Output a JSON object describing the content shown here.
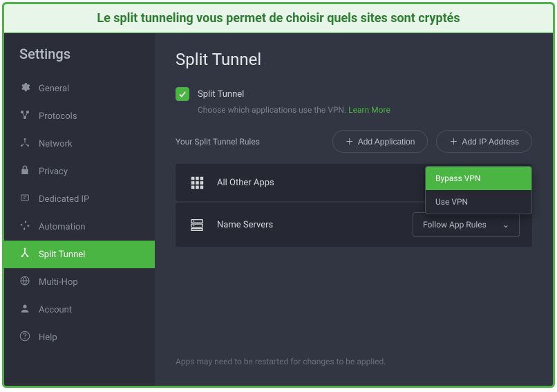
{
  "banner": {
    "text": "Le split tunneling vous permet de choisir quels sites sont cryptés"
  },
  "sidebar": {
    "title": "Settings",
    "items": [
      {
        "label": "General"
      },
      {
        "label": "Protocols"
      },
      {
        "label": "Network"
      },
      {
        "label": "Privacy"
      },
      {
        "label": "Dedicated IP"
      },
      {
        "label": "Automation"
      },
      {
        "label": "Split Tunnel"
      },
      {
        "label": "Multi-Hop"
      },
      {
        "label": "Account"
      },
      {
        "label": "Help"
      }
    ],
    "active_index": 6
  },
  "main": {
    "title": "Split Tunnel",
    "checkbox_label": "Split Tunnel",
    "helper_text": "Choose which applications use the VPN.",
    "learn_more": "Learn More",
    "rules_label": "Your Split Tunnel Rules",
    "add_app_btn": "Add Application",
    "add_ip_btn": "Add IP Address",
    "rules": [
      {
        "label": "All Other Apps"
      },
      {
        "label": "Name Servers",
        "select_value": "Follow App Rules"
      }
    ],
    "dropdown": {
      "options": [
        {
          "label": "Bypass VPN",
          "selected": true
        },
        {
          "label": "Use VPN",
          "selected": false
        }
      ]
    },
    "footer_note": "Apps may need to be restarted for changes to be applied."
  },
  "colors": {
    "accent": "#4BB543",
    "bg_main": "#323642",
    "bg_sidebar": "#2B2E39",
    "bg_card": "#262933"
  }
}
